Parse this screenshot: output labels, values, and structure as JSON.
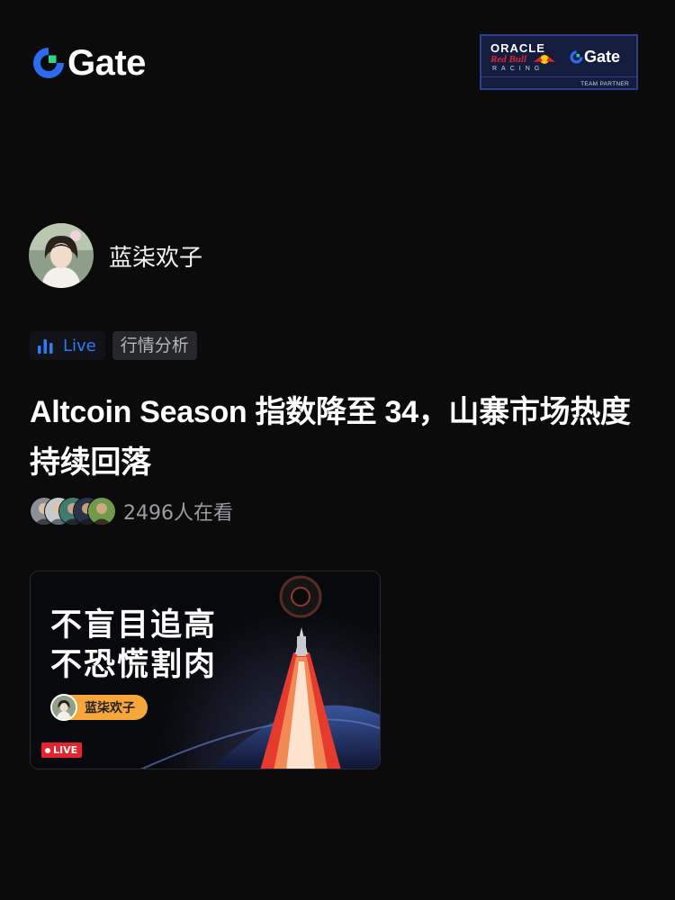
{
  "header": {
    "brand": "Gate",
    "partner": {
      "oracle": "ORACLE",
      "redbull": "Red Bull",
      "racing": "RACING",
      "gate": "Gate",
      "team_partner": "TEAM PARTNER"
    }
  },
  "author": {
    "name": "蓝柒欢子"
  },
  "tags": {
    "live": "Live",
    "category": "行情分析"
  },
  "post": {
    "title": "Altcoin Season 指数降至 34，山寨市场热度持续回落",
    "viewers": "2496人在看"
  },
  "card": {
    "line1": "不盲目追高",
    "line2": "不恐慌割肉",
    "host": "蓝柒欢子",
    "live": "LIVE"
  },
  "colors": {
    "accent_blue": "#2f7cf6",
    "live_red": "#e6242d",
    "pill_orange": "#f7a73a"
  }
}
